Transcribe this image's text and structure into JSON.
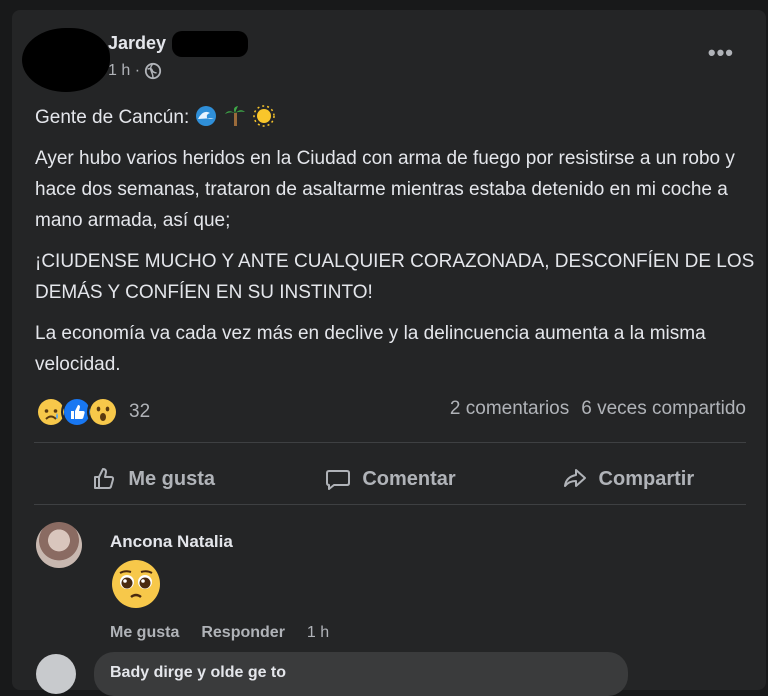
{
  "post": {
    "author": "Jardey",
    "time": "1 h ·",
    "privacy_icon": "globe-icon",
    "paragraphs": {
      "p1": "Gente de Cancún:",
      "p2": "Ayer hubo varios heridos en la Ciudad con arma de fuego por resistirse a un robo y hace dos semanas, trataron de asaltarme mientras estaba detenido en mi coche a mano armada, así que;",
      "p3": "¡CIUDENSE MUCHO Y ANTE CUALQUIER CORAZONADA, DESCONFÍEN DE LOS DEMÁS Y CONFÍEN EN SU INSTINTO!",
      "p4": "La economía va cada vez más en declive y la delincuencia aumenta a la misma velocidad."
    },
    "title_emojis": [
      "wave-icon",
      "palm-tree-icon",
      "sun-icon"
    ],
    "reactions": {
      "icons": [
        "sad-reaction-icon",
        "like-reaction-icon",
        "wow-reaction-icon"
      ],
      "count": "32"
    },
    "comments_count": "2 comentarios",
    "shares_count": "6 veces compartido"
  },
  "actions": {
    "like": "Me gusta",
    "comment": "Comentar",
    "share": "Compartir"
  },
  "comment": {
    "author": "Ancona Natalia",
    "emoji": "pleading-face-icon",
    "like": "Me gusta",
    "reply": "Responder",
    "time": "1 h"
  },
  "reply_preview": {
    "text": "Bady dirge y olde ge to"
  },
  "colors": {
    "background": "#18191a",
    "card": "#242526",
    "text_primary": "#e4e6eb",
    "text_secondary": "#b0b3b8",
    "like_blue": "#1877f2"
  }
}
